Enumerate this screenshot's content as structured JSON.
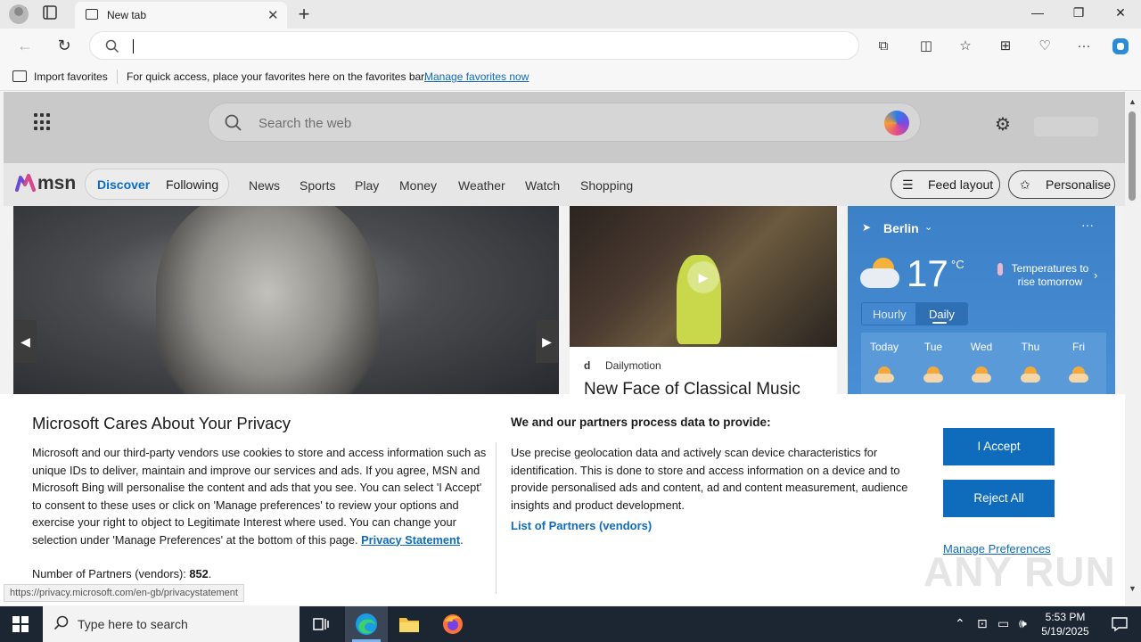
{
  "browser": {
    "tab_title": "New tab",
    "tab_close_glyph": "✕",
    "new_tab_glyph": "+",
    "window_controls": [
      "—",
      "❐",
      "✕"
    ]
  },
  "favorites_bar": {
    "import_label": "Import favorites",
    "hint": "For quick access, place your favorites here on the favorites bar.",
    "manage_link": "Manage favorites now"
  },
  "msn": {
    "search_placeholder": "Search the web",
    "logo_text": "msn",
    "pills": [
      "Discover",
      "Following"
    ],
    "nav": [
      "News",
      "Sports",
      "Play",
      "Money",
      "Weather",
      "Watch",
      "Shopping"
    ],
    "feed_layout": "Feed layout",
    "personalise": "Personalise"
  },
  "video_card": {
    "source_badge": "d",
    "source": "Dailymotion",
    "headline": "New Face of Classical Music"
  },
  "weather": {
    "city": "Berlin",
    "temp": "17",
    "unit": "°C",
    "alert": "Temperatures to rise tomorrow",
    "modes": [
      "Hourly",
      "Daily"
    ],
    "selected_mode": "Daily",
    "days": [
      "Today",
      "Tue",
      "Wed",
      "Thu",
      "Fri"
    ],
    "more_glyph": "···",
    "colors": {
      "panel": "#3c80c8",
      "days": "#5b9ad9"
    }
  },
  "consent": {
    "title": "Microsoft Cares About Your Privacy",
    "body": "Microsoft and our third-party vendors use cookies to store and access information such as unique IDs to deliver, maintain and improve our services and ads. If you agree, MSN and Microsoft Bing will personalise the content and ads that you see. You can select 'I Accept' to consent to these uses or click on 'Manage preferences' to review your options and exercise your right to object to Legitimate Interest where used.  You can change your selection under 'Manage Preferences' at the bottom of this page.",
    "privacy_link": "Privacy Statement",
    "partners_label": "Number of Partners (vendors):",
    "partners_count": "852",
    "subtitle": "We and our partners process data to provide:",
    "description": "Use precise geolocation data and actively scan device characteristics for identification. This is done to store and access information on a device and to provide personalised ads and content, ad and content measurement, audience insights and product development.",
    "vendors_link": "List of Partners (vendors)",
    "accept": "I Accept",
    "reject": "Reject All",
    "manage": "Manage Preferences",
    "accent": "#0f6cbd"
  },
  "status_url": "https://privacy.microsoft.com/en-gb/privacystatement",
  "watermark": "ANY RUN",
  "taskbar": {
    "search_placeholder": "Type here to search",
    "time": "5:53 PM",
    "date": "5/19/2025"
  }
}
